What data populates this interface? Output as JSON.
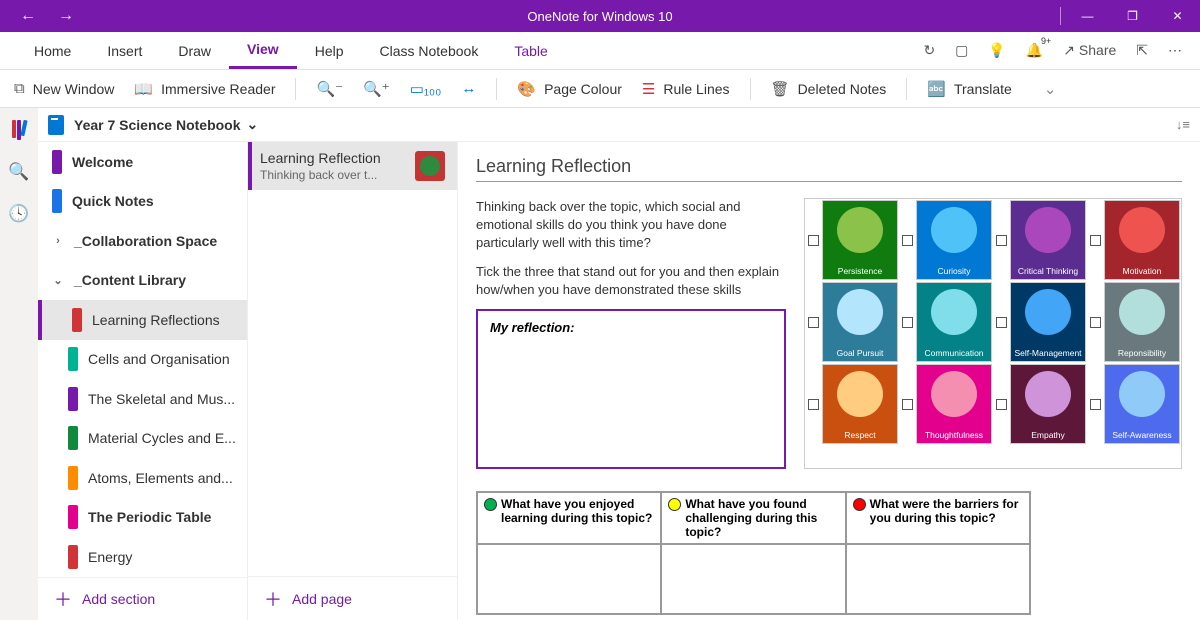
{
  "app": {
    "title": "OneNote for Windows 10"
  },
  "tabs": {
    "home": "Home",
    "insert": "Insert",
    "draw": "Draw",
    "view": "View",
    "help": "Help",
    "class": "Class Notebook",
    "table": "Table"
  },
  "ribbon_right": {
    "share": "Share",
    "bell_badge": "9+"
  },
  "commands": {
    "new_window": "New Window",
    "immersive": "Immersive Reader",
    "page_colour": "Page Colour",
    "rule_lines": "Rule Lines",
    "deleted_notes": "Deleted Notes",
    "translate": "Translate"
  },
  "notebook": {
    "name": "Year 7 Science Notebook"
  },
  "sections": [
    {
      "label": "Welcome",
      "color": "#7719AA",
      "bold": true
    },
    {
      "label": "Quick Notes",
      "color": "#1a73e8",
      "bold": true
    },
    {
      "label": "_Collaboration Space",
      "chev": "›",
      "bold": true
    },
    {
      "label": "_Content Library",
      "chev": "⌄",
      "bold": true
    },
    {
      "label": "Learning Reflections",
      "color": "#d13438",
      "sub": true,
      "sel": true
    },
    {
      "label": "Cells and Organisation",
      "color": "#00b294",
      "sub": true
    },
    {
      "label": "The Skeletal and Mus...",
      "color": "#7719AA",
      "sub": true
    },
    {
      "label": "Material Cycles and E...",
      "color": "#10893e",
      "sub": true
    },
    {
      "label": "Atoms, Elements and...",
      "color": "#ff8c00",
      "sub": true
    },
    {
      "label": "The Periodic Table",
      "color": "#e3008c",
      "sub": true,
      "bold": true
    },
    {
      "label": "Energy",
      "color": "#d13438",
      "sub": true
    }
  ],
  "add_section": "Add section",
  "pages": {
    "title": "Learning Reflection",
    "subtitle": "Thinking back over t..."
  },
  "add_page": "Add page",
  "page": {
    "title": "Learning Reflection",
    "para1": "Thinking back over the topic, which social and emotional skills do you think you have done particularly well with this time?",
    "para2": "Tick the three that stand out for you and then explain how/when you have demonstrated these skills",
    "reflection_label": "My reflection:"
  },
  "skills": [
    {
      "label": "Persistence",
      "bg": "#107c10",
      "circ": "#8bc34a"
    },
    {
      "label": "Curiosity",
      "bg": "#0078d4",
      "circ": "#4fc3f7"
    },
    {
      "label": "Critical Thinking",
      "bg": "#5c2d91",
      "circ": "#ab47bc"
    },
    {
      "label": "Motivation",
      "bg": "#a4262c",
      "circ": "#ef5350"
    },
    {
      "label": "Goal Pursuit",
      "bg": "#2d7d9a",
      "circ": "#b3e5fc"
    },
    {
      "label": "Communication",
      "bg": "#038387",
      "circ": "#80deea"
    },
    {
      "label": "Self-Management",
      "bg": "#003966",
      "circ": "#42a5f5"
    },
    {
      "label": "Reponsibility",
      "bg": "#69797e",
      "circ": "#b2dfdb"
    },
    {
      "label": "Respect",
      "bg": "#ca5010",
      "circ": "#ffcc80"
    },
    {
      "label": "Thoughtfulness",
      "bg": "#e3008c",
      "circ": "#f48fb1"
    },
    {
      "label": "Empathy",
      "bg": "#5d1738",
      "circ": "#ce93d8"
    },
    {
      "label": "Self-Awareness",
      "bg": "#4f6bed",
      "circ": "#90caf9"
    }
  ],
  "questions": {
    "q1": "What have you enjoyed learning during this topic?",
    "q2": "What have you found challenging during this topic?",
    "q3": "What were the barriers for you during this topic?",
    "c1": "#00b050",
    "c2": "#ffff00",
    "c3": "#ff0000"
  }
}
